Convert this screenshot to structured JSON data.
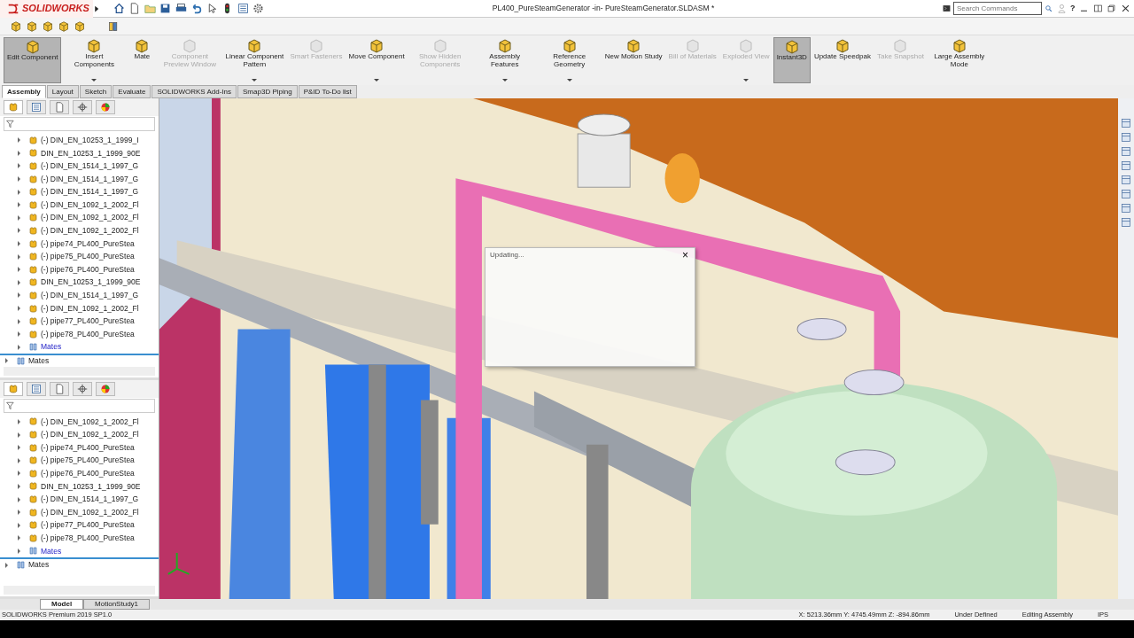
{
  "title_bar": {
    "app_name": "SOLIDWORKS",
    "document_title": "PL400_PureSteamGenerator -in- PureSteamGenerator.SLDASM *",
    "search": {
      "placeholder": "Search Commands"
    },
    "help": "?"
  },
  "ribbon": [
    {
      "label": "Edit Component",
      "selected": true,
      "disabled": false,
      "dropdown": false
    },
    {
      "label": "Insert Components",
      "selected": false,
      "disabled": false,
      "dropdown": true
    },
    {
      "label": "Mate",
      "selected": false,
      "disabled": false,
      "dropdown": false
    },
    {
      "label": "Component Preview Window",
      "selected": false,
      "disabled": true,
      "dropdown": false
    },
    {
      "label": "Linear Component Pattern",
      "selected": false,
      "disabled": false,
      "dropdown": true
    },
    {
      "label": "Smart Fasteners",
      "selected": false,
      "disabled": true,
      "dropdown": false
    },
    {
      "label": "Move Component",
      "selected": false,
      "disabled": false,
      "dropdown": true
    },
    {
      "label": "Show Hidden Components",
      "selected": false,
      "disabled": true,
      "dropdown": false
    },
    {
      "label": "Assembly Features",
      "selected": false,
      "disabled": false,
      "dropdown": true
    },
    {
      "label": "Reference Geometry",
      "selected": false,
      "disabled": false,
      "dropdown": true
    },
    {
      "label": "New Motion Study",
      "selected": false,
      "disabled": false,
      "dropdown": false
    },
    {
      "label": "Bill of Materials",
      "selected": false,
      "disabled": true,
      "dropdown": false
    },
    {
      "label": "Exploded View",
      "selected": false,
      "disabled": true,
      "dropdown": true
    },
    {
      "label": "Instant3D",
      "selected": true,
      "disabled": false,
      "dropdown": false
    },
    {
      "label": "Update Speedpak",
      "selected": false,
      "disabled": false,
      "dropdown": false
    },
    {
      "label": "Take Snapshot",
      "selected": false,
      "disabled": true,
      "dropdown": false
    },
    {
      "label": "Large Assembly Mode",
      "selected": false,
      "disabled": false,
      "dropdown": false
    }
  ],
  "command_tabs": [
    {
      "label": "Assembly",
      "selected": true
    },
    {
      "label": "Layout",
      "selected": false
    },
    {
      "label": "Sketch",
      "selected": false
    },
    {
      "label": "Evaluate",
      "selected": false
    },
    {
      "label": "SOLIDWORKS Add-Ins",
      "selected": false
    },
    {
      "label": "Smap3D Piping",
      "selected": false
    },
    {
      "label": "P&ID To-Do list",
      "selected": false
    }
  ],
  "tree_panes": [
    {
      "items": [
        {
          "label": "(-) DIN_EN_10253_1_1999_I",
          "kind": "component",
          "selected": false
        },
        {
          "label": "DIN_EN_10253_1_1999_90E",
          "kind": "component",
          "selected": false
        },
        {
          "label": "(-) DIN_EN_1514_1_1997_G",
          "kind": "component",
          "selected": false
        },
        {
          "label": "(-) DIN_EN_1514_1_1997_G",
          "kind": "component",
          "selected": false
        },
        {
          "label": "(-) DIN_EN_1514_1_1997_G",
          "kind": "component",
          "selected": false
        },
        {
          "label": "(-) DIN_EN_1092_1_2002_Fl",
          "kind": "component",
          "selected": false
        },
        {
          "label": "(-) DIN_EN_1092_1_2002_Fl",
          "kind": "component",
          "selected": false
        },
        {
          "label": "(-) DIN_EN_1092_1_2002_Fl",
          "kind": "component",
          "selected": false
        },
        {
          "label": "(-) pipe74_PL400_PureStea",
          "kind": "component",
          "selected": false
        },
        {
          "label": "(-) pipe75_PL400_PureStea",
          "kind": "component",
          "selected": false
        },
        {
          "label": "(-) pipe76_PL400_PureStea",
          "kind": "component",
          "selected": false
        },
        {
          "label": "DIN_EN_10253_1_1999_90E",
          "kind": "component",
          "selected": false
        },
        {
          "label": "(-) DIN_EN_1514_1_1997_G",
          "kind": "component",
          "selected": false
        },
        {
          "label": "(-) DIN_EN_1092_1_2002_Fl",
          "kind": "component",
          "selected": false
        },
        {
          "label": "(-) pipe77_PL400_PureStea",
          "kind": "component",
          "selected": false
        },
        {
          "label": "(-) pipe78_PL400_PureStea",
          "kind": "component",
          "selected": false
        },
        {
          "label": "Mates",
          "kind": "mates",
          "selected": true
        }
      ],
      "root_items": [
        {
          "label": "Mates",
          "kind": "mates",
          "selected": false
        }
      ]
    },
    {
      "items": [
        {
          "label": "(-) DIN_EN_1092_1_2002_Fl",
          "kind": "component",
          "selected": false
        },
        {
          "label": "(-) DIN_EN_1092_1_2002_Fl",
          "kind": "component",
          "selected": false
        },
        {
          "label": "(-) pipe74_PL400_PureStea",
          "kind": "component",
          "selected": false
        },
        {
          "label": "(-) pipe75_PL400_PureStea",
          "kind": "component",
          "selected": false
        },
        {
          "label": "(-) pipe76_PL400_PureStea",
          "kind": "component",
          "selected": false
        },
        {
          "label": "DIN_EN_10253_1_1999_90E",
          "kind": "component",
          "selected": false
        },
        {
          "label": "(-) DIN_EN_1514_1_1997_G",
          "kind": "component",
          "selected": false
        },
        {
          "label": "(-) DIN_EN_1092_1_2002_Fl",
          "kind": "component",
          "selected": false
        },
        {
          "label": "(-) pipe77_PL400_PureStea",
          "kind": "component",
          "selected": false
        },
        {
          "label": "(-) pipe78_PL400_PureStea",
          "kind": "component",
          "selected": false
        },
        {
          "label": "Mates",
          "kind": "mates",
          "selected": true
        }
      ],
      "root_items": [
        {
          "label": "Mates",
          "kind": "mates",
          "selected": false
        }
      ]
    }
  ],
  "progress_dialog": {
    "title": "Updating...",
    "close": "×"
  },
  "bottom_tabs": [
    {
      "label": "Model",
      "selected": true
    },
    {
      "label": "MotionStudy1",
      "selected": false
    }
  ],
  "status_bar": {
    "product": "SOLIDWORKS Premium 2019 SP1.0",
    "coordinates": "X: 5213.36mm Y: 4745.49mm Z: -894.86mm",
    "definition": "Under Defined",
    "mode": "Editing Assembly",
    "units": "IPS"
  }
}
